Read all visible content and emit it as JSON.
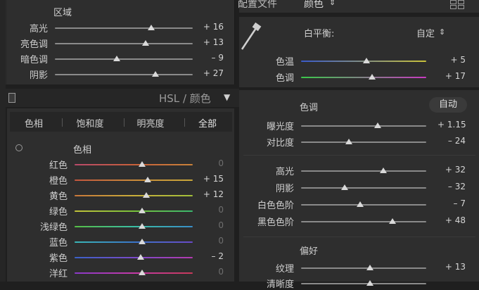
{
  "left": {
    "region_title": "区域",
    "region_sliders": [
      {
        "label": "高光",
        "value": "+ 16",
        "pct": 0.7
      },
      {
        "label": "亮色调",
        "value": "+ 13",
        "pct": 0.66
      },
      {
        "label": "暗色调",
        "value": "– 9",
        "pct": 0.45
      },
      {
        "label": "阴影",
        "value": "+ 27",
        "pct": 0.73
      }
    ],
    "hsl_header": {
      "hsl": "HSL",
      "sep": " / ",
      "color": "颜色",
      "arrow": "▼"
    },
    "tabs": [
      "色相",
      "饱和度",
      "明亮度",
      "全部"
    ],
    "hue_title": "色相",
    "hue_sliders": [
      {
        "label": "红色",
        "value": "0",
        "dim": true,
        "pct": 0.57,
        "grad": "linear-gradient(90deg,#b84a6b,#c8603a,#c9823a)"
      },
      {
        "label": "橙色",
        "value": "+ 15",
        "dim": false,
        "pct": 0.62,
        "grad": "linear-gradient(90deg,#c3563e,#c98a3a,#c9a83a)"
      },
      {
        "label": "黄色",
        "value": "+ 12",
        "dim": false,
        "pct": 0.61,
        "grad": "linear-gradient(90deg,#c9773a,#c9ad3a,#a2c03a)"
      },
      {
        "label": "绿色",
        "value": "0",
        "dim": true,
        "pct": 0.57,
        "grad": "linear-gradient(90deg,#c2c23a,#78c03a,#3ab86e)"
      },
      {
        "label": "浅绿色",
        "value": "0",
        "dim": true,
        "pct": 0.57,
        "grad": "linear-gradient(90deg,#57bf45,#3abfa4,#3a8ec9)"
      },
      {
        "label": "蓝色",
        "value": "0",
        "dim": true,
        "pct": 0.57,
        "grad": "linear-gradient(90deg,#3ab7b7,#3a76c9,#6a4ac9)"
      },
      {
        "label": "紫色",
        "value": "– 2",
        "dim": false,
        "pct": 0.56,
        "grad": "linear-gradient(90deg,#3a62c9,#7a4ac9,#b43ab0)"
      },
      {
        "label": "洋红",
        "value": "0",
        "dim": true,
        "pct": 0.57,
        "grad": "linear-gradient(90deg,#8a3ac9,#c43aa8,#c83a5a)"
      }
    ]
  },
  "right": {
    "top_label": "配置文件",
    "top_value": "颜色",
    "top_arrow": "⇕",
    "wb_label": "白平衡:",
    "wb_value": "自定",
    "wb_arrow": "⇕",
    "temp": {
      "label": "色温",
      "value": "+ 5",
      "pct": 0.52
    },
    "tint": {
      "label": "色调",
      "value": "+ 17",
      "pct": 0.57
    },
    "tone_title": "色调",
    "auto_btn": "自动",
    "exposure": [
      {
        "label": "曝光度",
        "value": "+ 1.15",
        "pct": 0.61
      },
      {
        "label": "对比度",
        "value": "– 24",
        "pct": 0.38
      }
    ],
    "tone_sliders": [
      {
        "label": "高光",
        "value": "+ 32",
        "pct": 0.66
      },
      {
        "label": "阴影",
        "value": "– 32",
        "pct": 0.35
      },
      {
        "label": "白色色阶",
        "value": "– 7",
        "pct": 0.47
      },
      {
        "label": "黑色色阶",
        "value": "+ 48",
        "pct": 0.73
      }
    ],
    "pref_title": "偏好",
    "pref_sliders": [
      {
        "label": "纹理",
        "value": "+ 13",
        "pct": 0.55
      },
      {
        "label": "清晰度",
        "value": "",
        "pct": 0.55
      }
    ]
  },
  "colors": {
    "thumb": "#d9d9d9",
    "panel": "#2b2b2b",
    "bg": "#1f1f1f"
  },
  "icons": [
    "eyedropper-icon",
    "target-adjust-icon",
    "panel-toggle-icon",
    "grid-view-icon"
  ]
}
